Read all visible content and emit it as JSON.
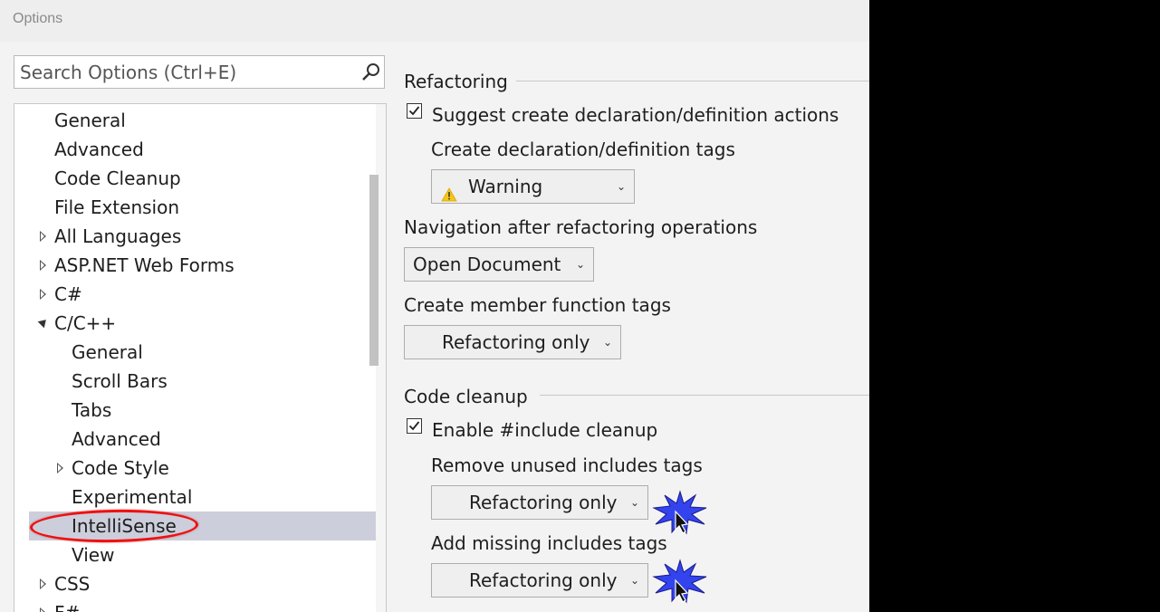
{
  "window": {
    "title": "Options"
  },
  "search": {
    "placeholder": "Search Options (Ctrl+E)"
  },
  "tree": {
    "items": [
      {
        "label": "General"
      },
      {
        "label": "Advanced"
      },
      {
        "label": "Code Cleanup"
      },
      {
        "label": "File Extension"
      },
      {
        "label": "All Languages"
      },
      {
        "label": "ASP.NET Web Forms"
      },
      {
        "label": "C#"
      },
      {
        "label": "C/C++"
      },
      {
        "label": "General"
      },
      {
        "label": "Scroll Bars"
      },
      {
        "label": "Tabs"
      },
      {
        "label": "Advanced"
      },
      {
        "label": "Code Style"
      },
      {
        "label": "Experimental"
      },
      {
        "label": "IntelliSense"
      },
      {
        "label": "View"
      },
      {
        "label": "CSS"
      },
      {
        "label": "F#"
      }
    ],
    "selected": "IntelliSense"
  },
  "refactoring": {
    "header": "Refactoring",
    "suggest_checkbox": {
      "label": "Suggest create declaration/definition actions",
      "checked": true
    },
    "decl_tags_label": "Create declaration/definition tags",
    "decl_tags_value": "Warning",
    "nav_label": "Navigation after refactoring operations",
    "nav_value": "Open Document",
    "member_tags_label": "Create member function tags",
    "member_tags_value": "Refactoring only"
  },
  "cleanup": {
    "header": "Code cleanup",
    "include_checkbox": {
      "label": "Enable #include cleanup",
      "checked": true
    },
    "remove_label": "Remove unused includes tags",
    "remove_value": "Refactoring only",
    "add_label": "Add missing includes tags",
    "add_value": "Refactoring only"
  },
  "colors": {
    "selection": "#cccedb",
    "highlight_ellipse": "#ee1111",
    "starburst": "#3344ee"
  }
}
